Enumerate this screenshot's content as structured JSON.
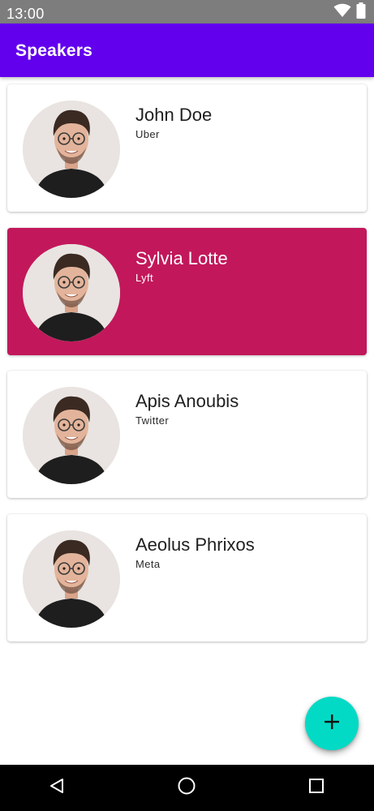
{
  "status_bar": {
    "time": "13:00",
    "icons": [
      "wifi-icon",
      "battery-icon"
    ]
  },
  "app_bar": {
    "title": "Speakers",
    "color": "#6200ee"
  },
  "speakers": [
    {
      "name": "John Doe",
      "company": "Uber",
      "selected": false
    },
    {
      "name": "Sylvia Lotte",
      "company": "Lyft",
      "selected": true
    },
    {
      "name": "Apis Anoubis",
      "company": "Twitter",
      "selected": false
    },
    {
      "name": "Aeolus Phrixos",
      "company": "Meta",
      "selected": false
    }
  ],
  "colors": {
    "selected_card": "#c2185b",
    "fab": "#03dac5",
    "status_bar": "#7d7d7d"
  },
  "fab": {
    "icon": "add-icon"
  },
  "nav_bar": {
    "buttons": [
      "back-icon",
      "home-icon",
      "recents-icon"
    ]
  }
}
